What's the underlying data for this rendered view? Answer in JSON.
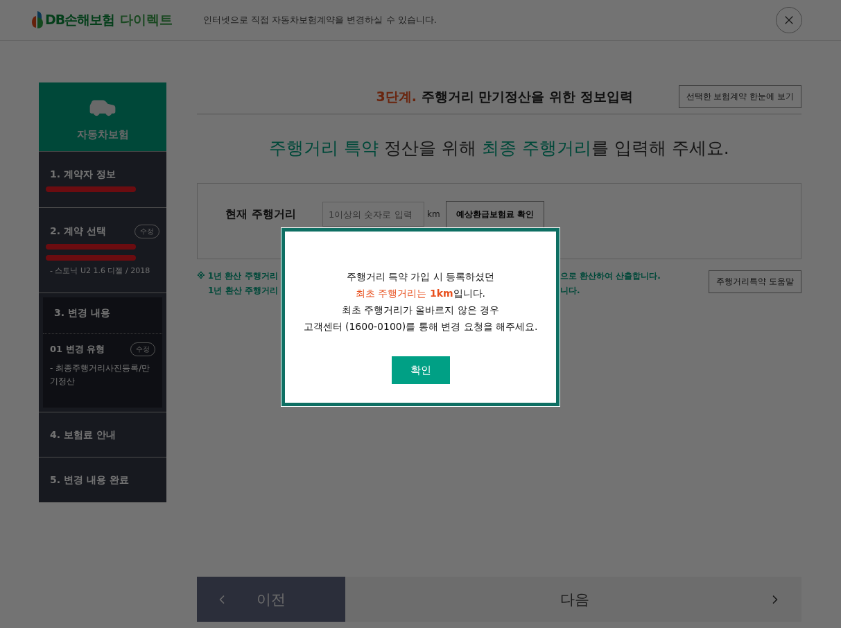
{
  "header": {
    "logo_text": "DB손해보험",
    "logo_suffix": "다이렉트",
    "tagline": "인터넷으로 직접 자동차보험계약을 변경하실 수 있습니다."
  },
  "sidebar": {
    "category": "자동차보험",
    "steps": [
      {
        "title": "1. 계약자 정보",
        "selected": false,
        "details": [
          {
            "kind": "redacted"
          }
        ]
      },
      {
        "title": "2. 계약 선택",
        "selected": false,
        "badge": "수정",
        "details": [
          {
            "kind": "redacted"
          },
          {
            "kind": "redacted"
          },
          {
            "kind": "text",
            "text": "- 스토닉 U2 1.6 디젤 / 2018"
          }
        ]
      },
      {
        "title": "3. 변경 내용",
        "selected": true,
        "substeps": [
          {
            "title": "01 변경 유형",
            "badge": "수정",
            "text": "- 최종주행거리사진등록/만기정산"
          }
        ]
      },
      {
        "title": "4. 보험료 안내",
        "selected": false
      },
      {
        "title": "5. 변경 내용 완료",
        "selected": false
      }
    ]
  },
  "main": {
    "step_label": "3단계.",
    "title": "주행거리 만기정산을 위한 정보입력",
    "view_button": "선택한 보험계약 한눈에 보기",
    "headline": [
      {
        "text": "주행거리 특약",
        "highlight": true
      },
      {
        "text": " 정산을 위해 ",
        "highlight": false
      },
      {
        "text": "최종 주행거리",
        "highlight": true
      },
      {
        "text": "를 입력해 주세요.",
        "highlight": false
      }
    ],
    "form": {
      "label": "현재 주행거리",
      "placeholder": "1이상의 숫자로 입력",
      "unit": "km",
      "button": "예상환급보험료 확인"
    },
    "notes_left": [
      "※ 1년 환산 주행거리",
      "1년 환산 주행거리"
    ],
    "notes_right": [
      "으로 환산하여 산출합니다.",
      "니다."
    ],
    "help_button": "주행거리특약 도움말"
  },
  "nav": {
    "prev": "이전",
    "next": "다음"
  },
  "dialog": {
    "lines": [
      [
        {
          "text": "주행거리 특약 가입 시 등록하셨던",
          "highlight": false
        }
      ],
      [
        {
          "text": "최초 주행거리는 ",
          "highlight": true
        },
        {
          "text": "1km",
          "highlight": true,
          "bold": true
        },
        {
          "text": "입니다.",
          "highlight": false
        }
      ],
      [
        {
          "text": "최초 주행거리가 올바르지 않은 경우",
          "highlight": false
        }
      ],
      [
        {
          "text": "고객센터 (1600-0100)를 통해 변경 요청을 해주세요.",
          "highlight": false
        }
      ]
    ],
    "button": "확인"
  }
}
